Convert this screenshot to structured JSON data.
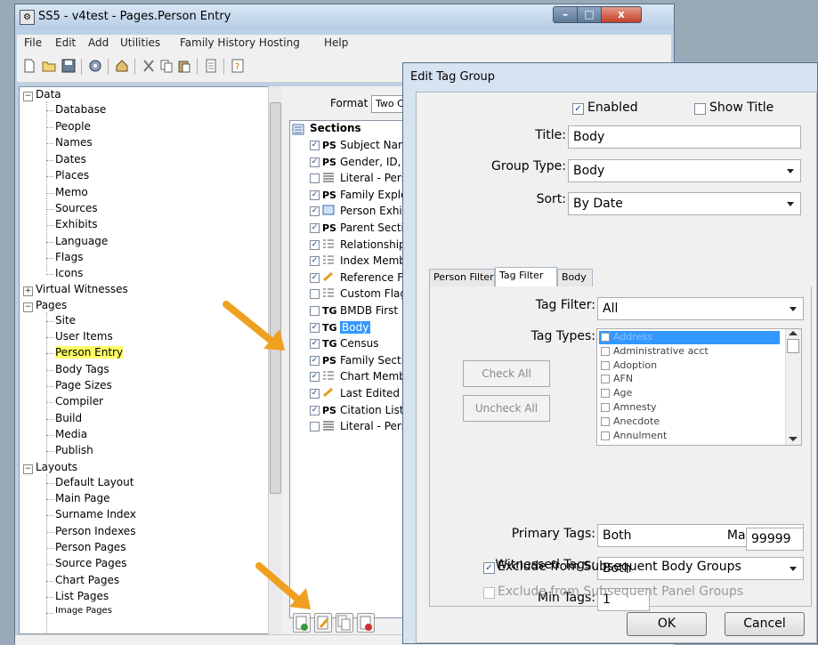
{
  "window": {
    "title": "SS5 - v4test - Pages.Person Entry",
    "controls": {
      "minimize": "–",
      "maximize": "□",
      "close": "x"
    }
  },
  "menu": [
    "File",
    "Edit",
    "Add",
    "Utilities",
    "Family History Hosting",
    "Help"
  ],
  "toolbar_icons": [
    "new-file-icon",
    "open-folder-icon",
    "save-icon",
    "settings-gear-icon",
    "home-icon",
    "cut-icon",
    "copy-icon",
    "paste-icon",
    "page-icon",
    "help-icon"
  ],
  "tree": {
    "data": {
      "label": "Data",
      "children": [
        "Database",
        "People",
        "Names",
        "Dates",
        "Places",
        "Memo",
        "Sources",
        "Exhibits",
        "Language",
        "Flags",
        "Icons"
      ]
    },
    "virtual_witnesses": "Virtual Witnesses",
    "pages": {
      "label": "Pages",
      "children": [
        "Site",
        "User Items",
        "Person Entry",
        "Body Tags",
        "Page Sizes",
        "Compiler",
        "Build",
        "Media",
        "Publish"
      ],
      "highlighted": "Person Entry"
    },
    "layouts": {
      "label": "Layouts",
      "children": [
        "Default Layout",
        "Main Page",
        "Surname Index",
        "Person Indexes",
        "Person Pages",
        "Source Pages",
        "Chart Pages",
        "List Pages",
        "Image Pages"
      ]
    }
  },
  "middle": {
    "format_label": "Format",
    "format_value": "Two Col",
    "sections_header": "Sections",
    "sections": [
      {
        "checked": true,
        "type": "PS",
        "label": "Subject Name"
      },
      {
        "checked": true,
        "type": "PS",
        "label": "Gender, ID, Lif"
      },
      {
        "checked": false,
        "type": "lines",
        "label": "Literal - Persor"
      },
      {
        "checked": true,
        "type": "PS",
        "label": "Family Explore"
      },
      {
        "checked": true,
        "type": "img",
        "label": "Person Exhibit"
      },
      {
        "checked": true,
        "type": "PS",
        "label": "Parent Section"
      },
      {
        "checked": true,
        "type": "list",
        "label": "Relationships"
      },
      {
        "checked": true,
        "type": "list",
        "label": "Index Member"
      },
      {
        "checked": true,
        "type": "pencil",
        "label": "Reference Fie"
      },
      {
        "checked": false,
        "type": "list",
        "label": "Custom Flags"
      },
      {
        "checked": false,
        "type": "TG",
        "label": "BMDB First"
      },
      {
        "checked": true,
        "type": "TG",
        "label": "Body",
        "selected": true
      },
      {
        "checked": true,
        "type": "TG",
        "label": "Census"
      },
      {
        "checked": true,
        "type": "PS",
        "label": "Family Section"
      },
      {
        "checked": true,
        "type": "list",
        "label": "Chart Member"
      },
      {
        "checked": true,
        "type": "pencil",
        "label": "Last Edited Da"
      },
      {
        "checked": true,
        "type": "PS",
        "label": "Citation List"
      },
      {
        "checked": false,
        "type": "lines",
        "label": "Literal - Persor"
      }
    ]
  },
  "dialog": {
    "title": "Edit Tag Group",
    "enabled_label": "Enabled",
    "enabled": true,
    "show_title_label": "Show Title",
    "show_title": false,
    "title_label": "Title:",
    "title_value": "Body",
    "group_type_label": "Group Type:",
    "group_type_value": "Body",
    "sort_label": "Sort:",
    "sort_value": "By Date",
    "tabs": [
      "Person Filter",
      "Tag Filter",
      "Body"
    ],
    "active_tab": "Tag Filter",
    "tag_filter_label": "Tag Filter:",
    "tag_filter_value": "All",
    "tag_types_label": "Tag Types:",
    "check_all": "Check All",
    "uncheck_all": "Uncheck All",
    "tag_types": [
      "Address",
      "Administrative acct",
      "Adoption",
      "AFN",
      "Age",
      "Amnesty",
      "Anecdote",
      "Annulment"
    ],
    "tag_types_selected": "Address",
    "primary_tags_label": "Primary Tags:",
    "primary_tags_value": "Both",
    "witnessed_tags_label": "Witnessed Tags:",
    "witnessed_tags_value": "Both",
    "min_tags_label": "Min Tags:",
    "min_tags_value": "1",
    "max_tags_label": "Max Tags:",
    "max_tags_value": "99999",
    "exclude_body_label": "Exclude from Subsequent Body Groups",
    "exclude_body": true,
    "exclude_panel_label": "Exclude from Subsequent Panel Groups",
    "exclude_panel": false,
    "ok": "OK",
    "cancel": "Cancel"
  },
  "colors": {
    "highlight": "#ffff66",
    "selection": "#3399ff",
    "arrow": "#f0a020"
  }
}
